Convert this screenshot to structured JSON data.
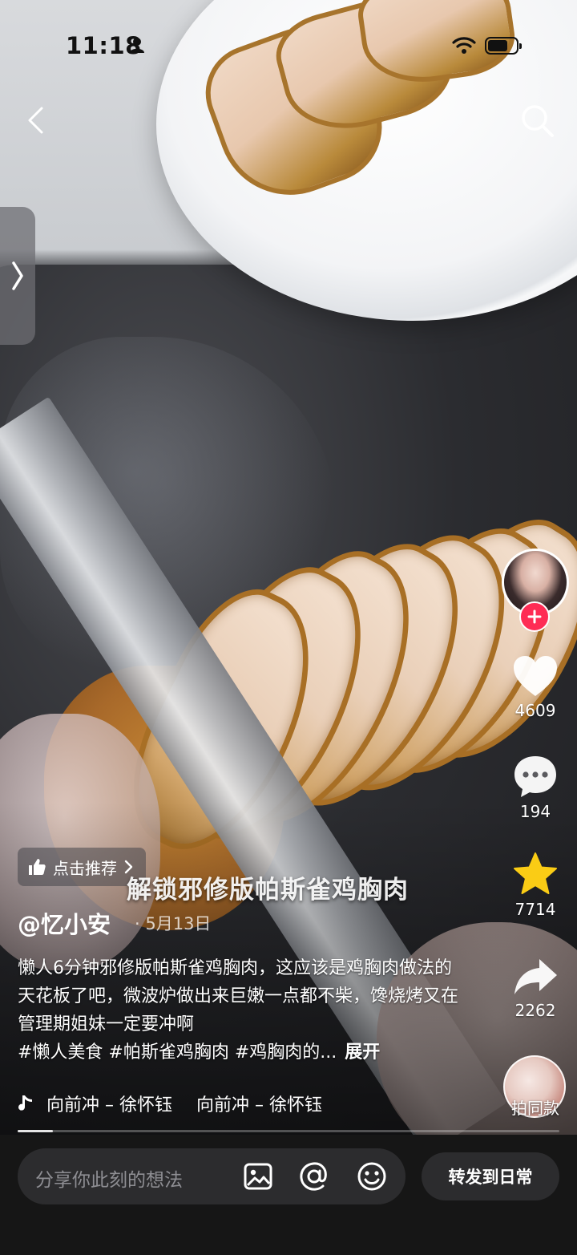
{
  "status_bar": {
    "time": "11:18"
  },
  "icons": {
    "back": "chevron-left-icon",
    "search": "search-icon",
    "drawer": "chevron-right-icon",
    "like": "heart-icon",
    "comment": "speech-bubble-icon",
    "favorite": "star-icon",
    "share": "share-arrow-icon",
    "image": "image-icon",
    "mention": "at-icon",
    "emoji": "smile-icon",
    "music": "music-note-icon"
  },
  "colors": {
    "like": "#ffffff",
    "favorite": "#facc15",
    "follow_plus": "#fe2c55"
  },
  "actions": {
    "likes": "4609",
    "comments": "194",
    "favorites": "7714",
    "shares": "2262",
    "record_label": "拍同款"
  },
  "recommend_chip": {
    "label": "点击推荐"
  },
  "video": {
    "title": "解锁邪修版帕斯雀鸡胸肉",
    "author": "@忆小安",
    "date": "· 5月13日",
    "caption": "懒人6分钟邪修版帕斯雀鸡胸肉，这应该是鸡胸肉做法的天花板了吧，微波炉做出来巨嫩一点都不柴，馋烧烤又在管理期姐妹一定要冲啊",
    "tags": "#懒人美食 #帕斯雀鸡胸肉 #鸡胸肉的...",
    "expand": "展开",
    "music": [
      "向前冲 – 徐怀钰",
      "向前冲 – 徐怀钰"
    ],
    "progress": 0.065
  },
  "comment_bar": {
    "placeholder": "分享你此刻的想法",
    "share_label": "转发到日常"
  }
}
